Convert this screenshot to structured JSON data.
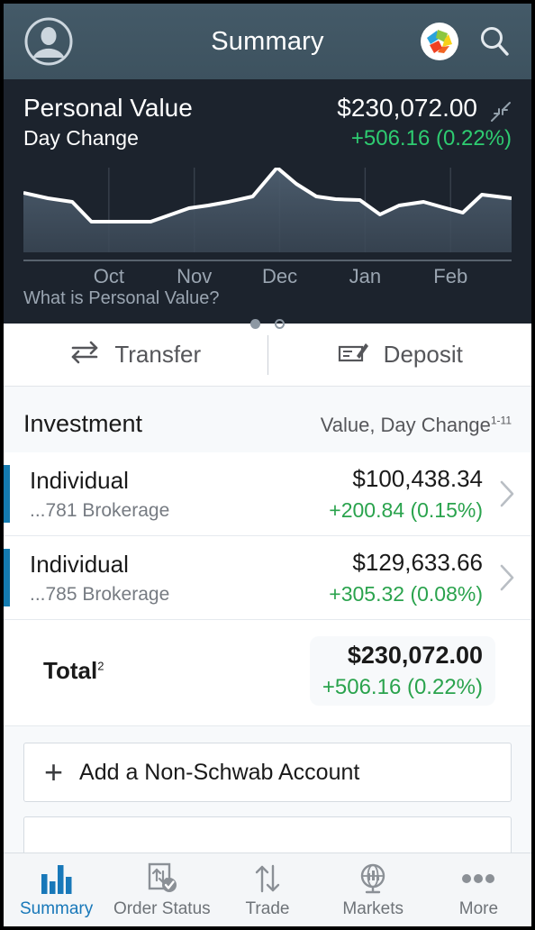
{
  "appbar": {
    "title": "Summary",
    "avatar_icon": "account-avatar-icon",
    "logo_icon": "schwab-pinwheel-logo",
    "search_icon": "search-icon"
  },
  "hero": {
    "label": "Personal Value",
    "value": "$230,072.00",
    "sublabel": "Day Change",
    "change": "+506.16 (0.22%)",
    "collapse_icon": "collapse-icon",
    "link": "What is Personal Value?",
    "positive_color": "#2ecc71",
    "panel_color": "#1c232d"
  },
  "carousel": {
    "total": 2,
    "active_index": 0
  },
  "actions": {
    "transfer": {
      "label": "Transfer",
      "icon": "transfer-arrows-icon"
    },
    "deposit": {
      "label": "Deposit",
      "icon": "check-deposit-icon"
    }
  },
  "investment": {
    "title": "Investment",
    "meta_text": "Value, Day Change",
    "meta_sup": "1-11",
    "accounts": [
      {
        "name": "Individual",
        "sub": "...781  Brokerage",
        "value": "$100,438.34",
        "change": "+200.84 (0.15%)",
        "accent_color": "#147bb0"
      },
      {
        "name": "Individual",
        "sub": "...785  Brokerage",
        "value": "$129,633.66",
        "change": "+305.32 (0.08%)",
        "accent_color": "#147bb0"
      }
    ],
    "total": {
      "label": "Total",
      "label_sup": "2",
      "value": "$230,072.00",
      "change": "+506.16 (0.22%)"
    }
  },
  "add_account": {
    "label": "Add a Non-Schwab Account",
    "plus": "+"
  },
  "tabs": [
    {
      "label": "Summary",
      "icon": "bar-chart-icon",
      "active": true
    },
    {
      "label": "Order Status",
      "icon": "order-status-icon",
      "active": false
    },
    {
      "label": "Trade",
      "icon": "trade-arrows-icon",
      "active": false
    },
    {
      "label": "Markets",
      "icon": "markets-globe-icon",
      "active": false
    },
    {
      "label": "More",
      "icon": "more-dots-icon",
      "active": false
    }
  ],
  "chart_data": {
    "type": "area",
    "title": "Personal Value history",
    "xlabel": "",
    "ylabel": "",
    "grid": true,
    "legend": "none",
    "tick_labels": [
      "Oct",
      "Nov",
      "Dec",
      "Jan",
      "Feb"
    ],
    "tick_positions_pct": [
      17.5,
      35.0,
      52.5,
      70.0,
      87.5
    ],
    "x": [
      0,
      5,
      10,
      14,
      18,
      26,
      34,
      38,
      42,
      47,
      52,
      56,
      60,
      64,
      69,
      73,
      77,
      82,
      86,
      90,
      94,
      100
    ],
    "values": [
      72,
      66,
      62,
      40,
      40,
      40,
      55,
      58,
      62,
      68,
      100,
      82,
      68,
      65,
      64,
      48,
      58,
      62,
      56,
      50,
      70,
      66
    ],
    "ylim": [
      0,
      100
    ],
    "line_color": "#ffffff",
    "fill_color": "#42505f",
    "background": "#1c232d"
  }
}
